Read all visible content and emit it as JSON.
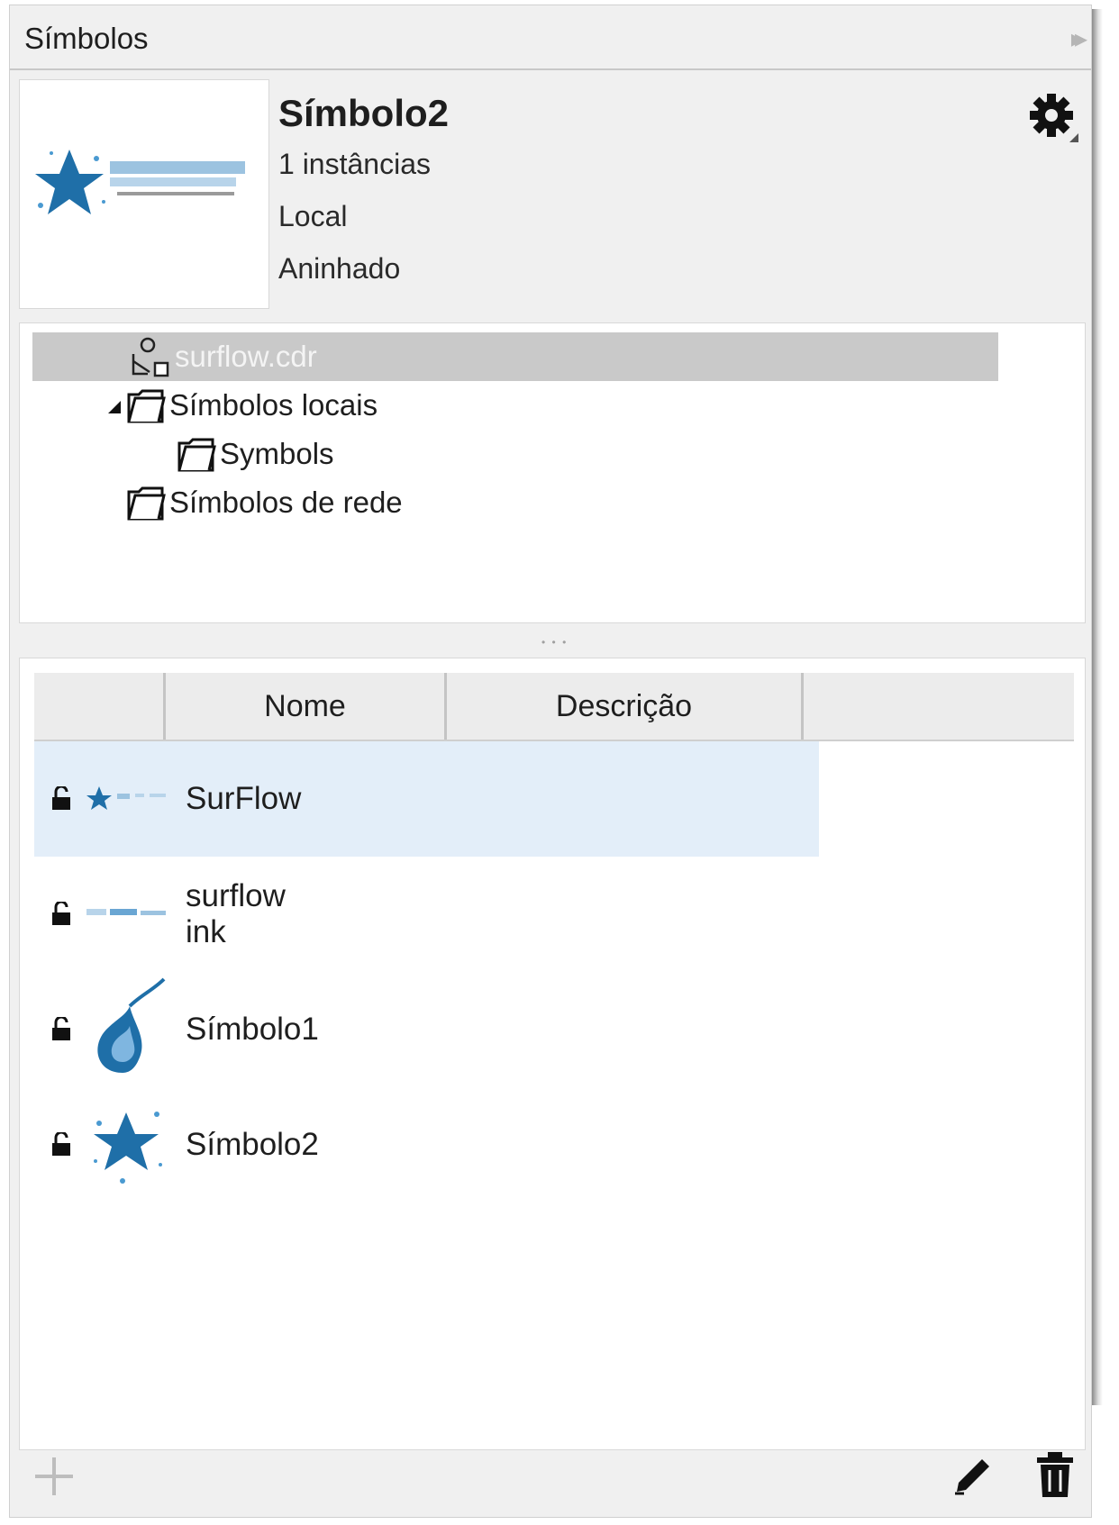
{
  "panel": {
    "title": "Símbolos"
  },
  "info": {
    "name": "Símbolo2",
    "instances": "1 instâncias",
    "scope": "Local",
    "type": "Aninhado"
  },
  "tree": {
    "root": "surflow.cdr",
    "local": "Símbolos locais",
    "symbols": "Symbols",
    "network": "Símbolos de rede"
  },
  "table": {
    "columns": [
      "",
      "Nome",
      "Descrição",
      ""
    ],
    "rows": [
      {
        "name": "SurFlow",
        "selected": true
      },
      {
        "name": "surflow ink",
        "selected": false
      },
      {
        "name": "Símbolo1",
        "selected": false
      },
      {
        "name": "Símbolo2",
        "selected": false
      }
    ]
  },
  "colors": {
    "selection": "#e3eef9",
    "tree_selection": "#c9c9c9",
    "logo_blue": "#1f6fa8"
  },
  "icons": [
    "collapse-icon",
    "gear-icon",
    "library-icon",
    "folder-icon",
    "lock-icon",
    "add-icon",
    "edit-icon",
    "delete-icon"
  ]
}
